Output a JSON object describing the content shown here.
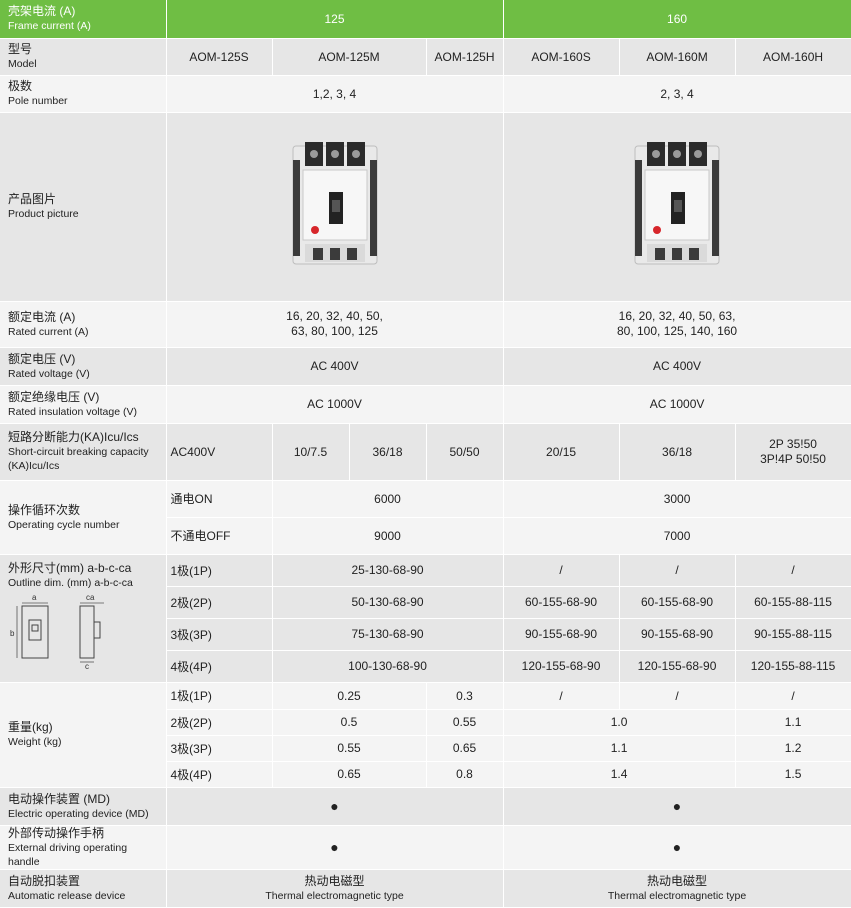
{
  "header": {
    "frame_zh": "壳架电流 (A)",
    "frame_en": "Frame current (A)",
    "frame_125": "125",
    "frame_160": "160"
  },
  "model": {
    "zh": "型号",
    "en": "Model",
    "values": [
      "AOM-125S",
      "AOM-125M",
      "AOM-125H",
      "AOM-160S",
      "AOM-160M",
      "AOM-160H"
    ]
  },
  "poles": {
    "zh": "极数",
    "en": "Pole number",
    "v125": "1,2, 3, 4",
    "v160": "2, 3, 4"
  },
  "picture": {
    "zh": "产品图片",
    "en": "Product picture"
  },
  "rated_current": {
    "zh": "额定电流 (A)",
    "en": "Rated current (A)",
    "v125_l1": "16, 20, 32, 40, 50,",
    "v125_l2": "63, 80, 100, 125",
    "v160_l1": "16, 20, 32, 40, 50, 63,",
    "v160_l2": "80, 100, 125, 140, 160"
  },
  "rated_voltage": {
    "zh": "额定电压  (V)",
    "en": "Rated voltage (V)",
    "v125": "AC 400V",
    "v160": "AC 400V"
  },
  "insulation_voltage": {
    "zh": "额定绝缘电压 (V)",
    "en": "Rated insulation voltage (V)",
    "v125": "AC 1000V",
    "v160": "AC 1000V"
  },
  "breaking": {
    "zh": "短路分断能力(KA)Icu/Ics",
    "en_l1": "Short-circuit breaking capacity",
    "en_l2": "(KA)Icu/Ics",
    "sub": "AC400V",
    "values": [
      "10/7.5",
      "36/18",
      "50/50",
      "20/15",
      "36/18"
    ],
    "h160_l1": "2P  35!50",
    "h160_l2": "3P!4P  50!50"
  },
  "cycles": {
    "zh": "操作循环次数",
    "en": "Operating cycle number",
    "on_label": "通电ON",
    "off_label": "不通电OFF",
    "on125": "6000",
    "on160": "3000",
    "off125": "9000",
    "off160": "7000"
  },
  "outline": {
    "zh": "外形尺寸(mm) a-b-c-ca",
    "en": "Outline dim. (mm) a-b-c-ca",
    "diagram_labels": {
      "a": "a",
      "ca": "ca",
      "b": "b",
      "c": "c"
    },
    "rows": [
      {
        "label": "1极(1P)",
        "v125": "25-130-68-90",
        "s": "/",
        "m": "/",
        "h": "/"
      },
      {
        "label": "2极(2P)",
        "v125": "50-130-68-90",
        "s": "60-155-68-90",
        "m": "60-155-68-90",
        "h": "60-155-88-115"
      },
      {
        "label": "3极(3P)",
        "v125": "75-130-68-90",
        "s": "90-155-68-90",
        "m": "90-155-68-90",
        "h": "90-155-88-115"
      },
      {
        "label": "4极(4P)",
        "v125": "100-130-68-90",
        "s": "120-155-68-90",
        "m": "120-155-68-90",
        "h": "120-155-88-115"
      }
    ]
  },
  "weight": {
    "zh": "重量(kg)",
    "en": "Weight (kg)",
    "rows": [
      {
        "label": "1极(1P)",
        "sm125": "0.25",
        "h125": "0.3",
        "s160": "/",
        "m160": "/",
        "h160": "/"
      },
      {
        "label": "2极(2P)",
        "sm125": "0.5",
        "h125": "0.55",
        "sm160": "1.0",
        "h160": "1.1"
      },
      {
        "label": "3极(3P)",
        "sm125": "0.55",
        "h125": "0.65",
        "sm160": "1.1",
        "h160": "1.2"
      },
      {
        "label": "4极(4P)",
        "sm125": "0.65",
        "h125": "0.8",
        "sm160": "1.4",
        "h160": "1.5"
      }
    ]
  },
  "md": {
    "zh": "电动操作装置 (MD)",
    "en": "Electric operating device (MD)",
    "v125": "●",
    "v160": "●"
  },
  "handle": {
    "zh": "外部传动操作手柄",
    "en": "External driving operating handle",
    "v125": "●",
    "v160": "●"
  },
  "release": {
    "zh": "自动脱扣装置",
    "en": "Automatic release device",
    "v_zh": "热动电磁型",
    "v_en": "Thermal electromagnetic type"
  },
  "colors": {
    "header_green": "#6fbe44",
    "row_gray": "#e6e6e6",
    "row_light": "#f4f4f4"
  }
}
